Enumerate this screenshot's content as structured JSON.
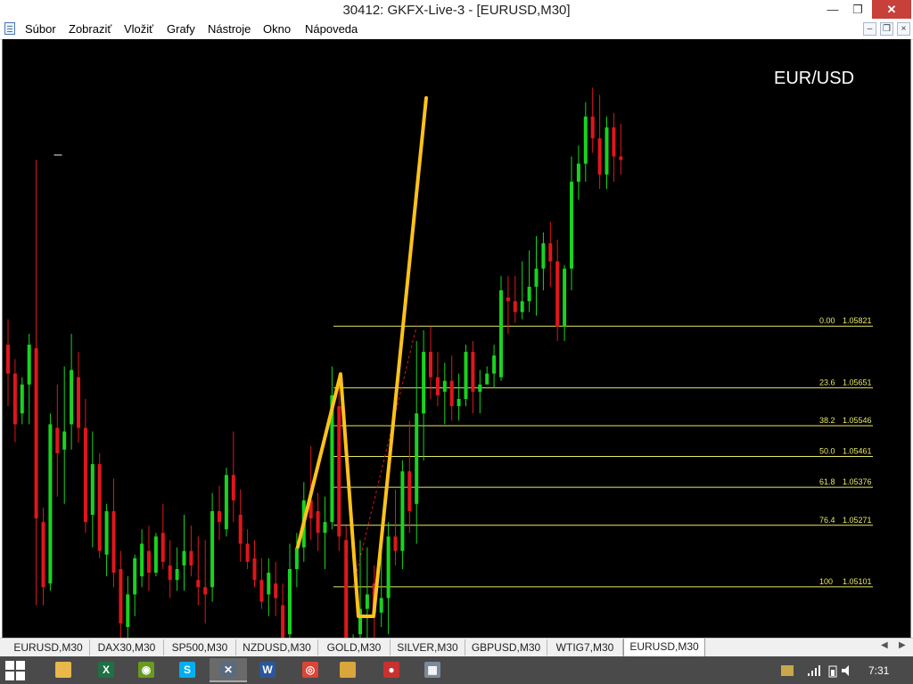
{
  "window": {
    "title": "30412: GKFX-Live-3 - [EURUSD,M30]"
  },
  "menu": {
    "items": [
      "Súbor",
      "Zobraziť",
      "Vložiť",
      "Grafy",
      "Nástroje",
      "Okno",
      "Nápoveda"
    ]
  },
  "chart": {
    "symbol_label": "EUR/USD",
    "dash_text": "---"
  },
  "chart_data": {
    "type": "candlestick",
    "title": "EUR/USD",
    "symbol": "EURUSD",
    "timeframe": "M30",
    "ylim": [
      1.0499,
      1.0654
    ],
    "grid": false,
    "colors": {
      "background": "#000000",
      "up": "#19d31f",
      "down": "#e0161c",
      "fib": "#e8e866",
      "fib_text": "#e8e866",
      "drawing": "#ffc21a"
    },
    "fibonacci": [
      {
        "level": "0.00",
        "price": "1.05821",
        "value": 1.05821
      },
      {
        "level": "23.6",
        "price": "1.05651",
        "value": 1.05651
      },
      {
        "level": "38.2",
        "price": "1.05546",
        "value": 1.05546
      },
      {
        "level": "50.0",
        "price": "1.05461",
        "value": 1.05461
      },
      {
        "level": "61.8",
        "price": "1.05376",
        "value": 1.05376
      },
      {
        "level": "76.4",
        "price": "1.05271",
        "value": 1.05271
      },
      {
        "level": "100",
        "price": "1.05101",
        "value": 1.05101
      }
    ],
    "candles": [
      [
        1.0577,
        1.0584,
        1.056,
        1.0569
      ],
      [
        1.0569,
        1.0573,
        1.055,
        1.0555
      ],
      [
        1.0558,
        1.0568,
        1.0555,
        1.0566
      ],
      [
        1.0566,
        1.058,
        1.0555,
        1.0577
      ],
      [
        1.0576,
        1.0628,
        1.0505,
        1.0529
      ],
      [
        1.0528,
        1.0532,
        1.0505,
        1.051
      ],
      [
        1.0511,
        1.0558,
        1.0509,
        1.0555
      ],
      [
        1.0554,
        1.0566,
        1.0535,
        1.0547
      ],
      [
        1.0548,
        1.0571,
        1.0533,
        1.0553
      ],
      [
        1.0555,
        1.058,
        1.0548,
        1.057
      ],
      [
        1.0568,
        1.0575,
        1.055,
        1.0554
      ],
      [
        1.0554,
        1.0562,
        1.0525,
        1.0528
      ],
      [
        1.053,
        1.0553,
        1.0521,
        1.0544
      ],
      [
        1.0544,
        1.0547,
        1.0518,
        1.052
      ],
      [
        1.0519,
        1.0533,
        1.0513,
        1.0531
      ],
      [
        1.0531,
        1.054,
        1.051,
        1.0514
      ],
      [
        1.0515,
        1.052,
        1.0495,
        1.05
      ],
      [
        1.0499,
        1.0513,
        1.0494,
        1.0508
      ],
      [
        1.0508,
        1.0519,
        1.0502,
        1.0518
      ],
      [
        1.0513,
        1.0526,
        1.051,
        1.0522
      ],
      [
        1.052,
        1.0527,
        1.0509,
        1.0514
      ],
      [
        1.0514,
        1.0525,
        1.0513,
        1.0524
      ],
      [
        1.0525,
        1.0533,
        1.0515,
        1.0517
      ],
      [
        1.0516,
        1.0523,
        1.0507,
        1.0512
      ],
      [
        1.0512,
        1.0521,
        1.0509,
        1.0515
      ],
      [
        1.0516,
        1.053,
        1.0509,
        1.052
      ],
      [
        1.052,
        1.0527,
        1.0513,
        1.0516
      ],
      [
        1.0512,
        1.0524,
        1.0505,
        1.051
      ],
      [
        1.051,
        1.0523,
        1.05,
        1.0508
      ],
      [
        1.051,
        1.0536,
        1.0506,
        1.0531
      ],
      [
        1.0531,
        1.0538,
        1.0523,
        1.0528
      ],
      [
        1.0526,
        1.0543,
        1.0524,
        1.0541
      ],
      [
        1.0541,
        1.0553,
        1.0528,
        1.0534
      ],
      [
        1.053,
        1.0537,
        1.0517,
        1.0522
      ],
      [
        1.0522,
        1.0526,
        1.0515,
        1.0517
      ],
      [
        1.0518,
        1.0523,
        1.051,
        1.0512
      ],
      [
        1.0512,
        1.0518,
        1.0504,
        1.0506
      ],
      [
        1.0508,
        1.0518,
        1.0502,
        1.0514
      ],
      [
        1.0511,
        1.0517,
        1.0502,
        1.0507
      ],
      [
        1.0505,
        1.0511,
        1.0494,
        1.0496
      ],
      [
        1.0497,
        1.0522,
        1.0491,
        1.0515
      ],
      [
        1.0515,
        1.0525,
        1.051,
        1.0521
      ],
      [
        1.0521,
        1.0539,
        1.0517,
        1.0534
      ],
      [
        1.0534,
        1.0549,
        1.0523,
        1.0529
      ],
      [
        1.0531,
        1.0536,
        1.052,
        1.0525
      ],
      [
        1.0525,
        1.0535,
        1.0515,
        1.0528
      ],
      [
        1.0528,
        1.0571,
        1.0526,
        1.0563
      ],
      [
        1.056,
        1.0569,
        1.052,
        1.0524
      ],
      [
        1.0523,
        1.0527,
        1.0482,
        1.0487
      ],
      [
        1.0487,
        1.0497,
        1.0479,
        1.0493
      ],
      [
        1.0497,
        1.0523,
        1.049,
        1.0504
      ],
      [
        1.0504,
        1.0521,
        1.0494,
        1.0508
      ],
      [
        1.0511,
        1.0516,
        1.0493,
        1.0503
      ],
      [
        1.0503,
        1.0522,
        1.0499,
        1.0507
      ],
      [
        1.0507,
        1.0528,
        1.0497,
        1.0524
      ],
      [
        1.0524,
        1.0537,
        1.0516,
        1.052
      ],
      [
        1.052,
        1.0545,
        1.0515,
        1.0542
      ],
      [
        1.0542,
        1.0556,
        1.0525,
        1.0531
      ],
      [
        1.0533,
        1.0578,
        1.0522,
        1.0558
      ],
      [
        1.0558,
        1.0581,
        1.0545,
        1.0575
      ],
      [
        1.0575,
        1.0582,
        1.0562,
        1.0568
      ],
      [
        1.0568,
        1.0575,
        1.056,
        1.0563
      ],
      [
        1.0564,
        1.0572,
        1.0555,
        1.0567
      ],
      [
        1.0567,
        1.0574,
        1.0556,
        1.056
      ],
      [
        1.056,
        1.0569,
        1.0556,
        1.0562
      ],
      [
        1.0562,
        1.0577,
        1.056,
        1.0575
      ],
      [
        1.0575,
        1.0578,
        1.0558,
        1.0564
      ],
      [
        1.0564,
        1.057,
        1.0558,
        1.0566
      ],
      [
        1.0566,
        1.0571,
        1.0567,
        1.0569
      ],
      [
        1.0569,
        1.0577,
        1.0565,
        1.0574
      ],
      [
        1.0568,
        1.0596,
        1.0567,
        1.0592
      ],
      [
        1.059,
        1.0596,
        1.058,
        1.0589
      ],
      [
        1.0589,
        1.0596,
        1.0583,
        1.0586
      ],
      [
        1.0586,
        1.06,
        1.0584,
        1.0589
      ],
      [
        1.0589,
        1.0603,
        1.0586,
        1.0593
      ],
      [
        1.0593,
        1.0607,
        1.0585,
        1.0598
      ],
      [
        1.0598,
        1.0608,
        1.0592,
        1.0605
      ],
      [
        1.0605,
        1.0611,
        1.0593,
        1.06
      ],
      [
        1.06,
        1.0606,
        1.0578,
        1.0582
      ],
      [
        1.0582,
        1.0599,
        1.0578,
        1.0598
      ],
      [
        1.0598,
        1.0629,
        1.0592,
        1.0622
      ],
      [
        1.0622,
        1.0632,
        1.0617,
        1.0627
      ],
      [
        1.0627,
        1.0644,
        1.0622,
        1.064
      ],
      [
        1.064,
        1.0648,
        1.063,
        1.0634
      ],
      [
        1.0634,
        1.0646,
        1.062,
        1.0624
      ],
      [
        1.0624,
        1.064,
        1.062,
        1.0637
      ],
      [
        1.0637,
        1.0641,
        1.0622,
        1.0629
      ],
      [
        1.0629,
        1.0638,
        1.0624,
        1.0628
      ]
    ]
  },
  "tabs": [
    "EURUSD,M30",
    "DAX30,M30",
    "SP500,M30",
    "NZDUSD,M30",
    "GOLD,M30",
    "SILVER,M30",
    "GBPUSD,M30",
    "WTIG7,M30",
    "EURUSD,M30"
  ],
  "taskbar": {
    "clock": "7:31",
    "apps": [
      {
        "name": "file-explorer-icon",
        "glyph": "",
        "color": "#e8b84a"
      },
      {
        "name": "excel-icon",
        "glyph": "X",
        "color": "#1e7145"
      },
      {
        "name": "chrome-green-icon",
        "glyph": "◉",
        "color": "#6a9a1f"
      },
      {
        "name": "skype-icon",
        "glyph": "S",
        "color": "#00aff0"
      },
      {
        "name": "metatrader-icon",
        "glyph": "✕",
        "color": "#5a6a80"
      },
      {
        "name": "word-icon",
        "glyph": "W",
        "color": "#2b579a"
      },
      {
        "name": "chrome-icon",
        "glyph": "◎",
        "color": "#db4437"
      },
      {
        "name": "explorer-folder-icon",
        "glyph": "",
        "color": "#d8a63a"
      },
      {
        "name": "app-red-blue-icon",
        "glyph": "●",
        "color": "#c93030"
      },
      {
        "name": "calculator-icon",
        "glyph": "▦",
        "color": "#7a8a9a"
      }
    ]
  }
}
